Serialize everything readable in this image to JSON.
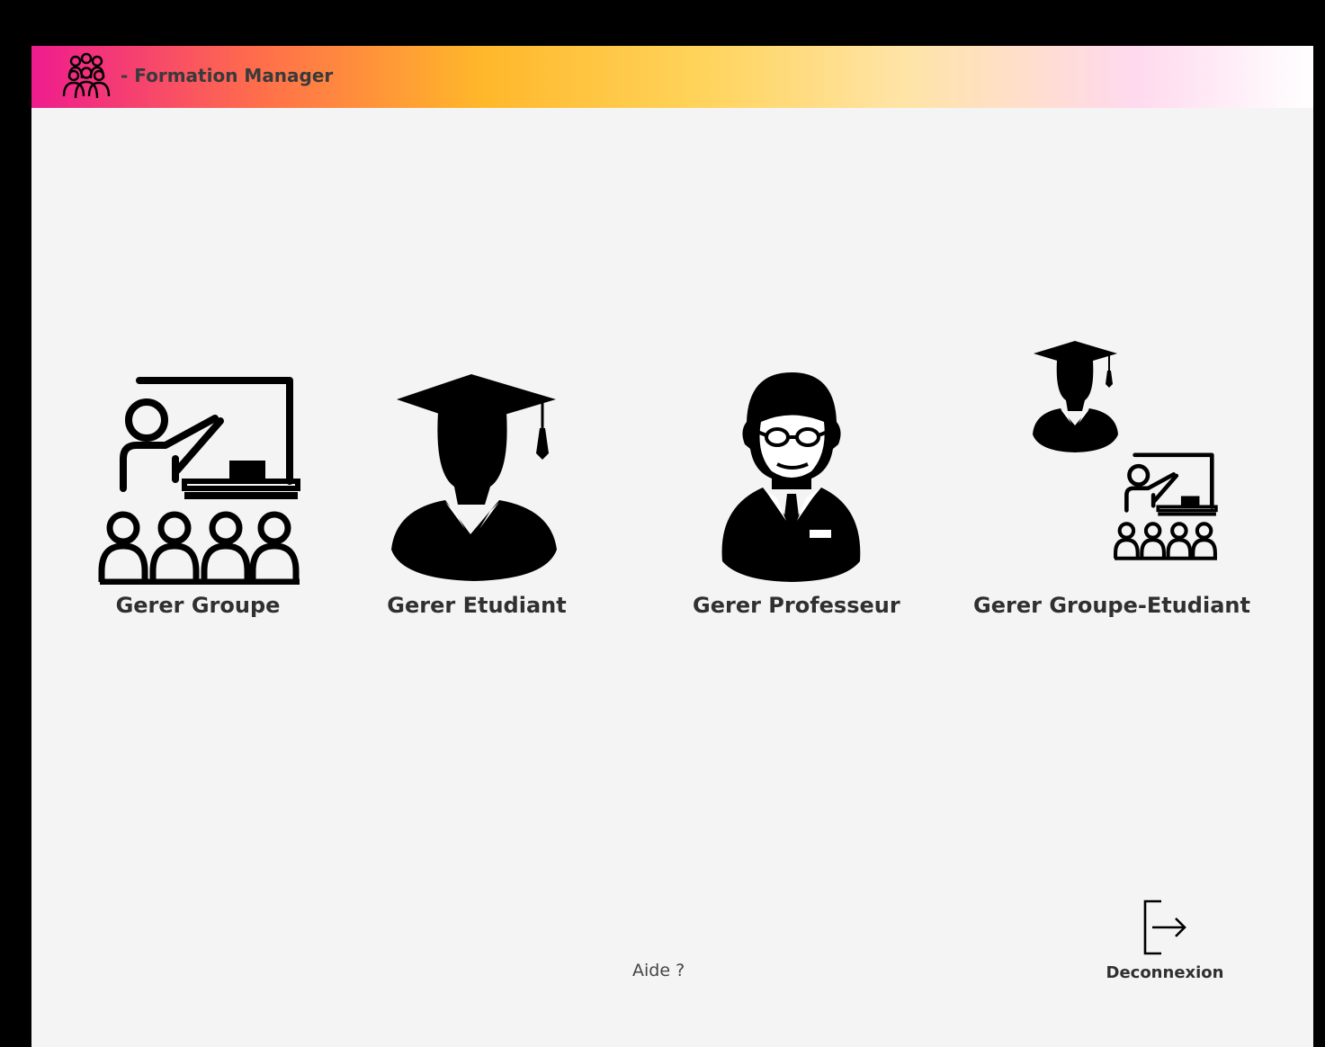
{
  "window": {
    "title": "- Formation Manager",
    "logo_icon": "group-of-people-icon"
  },
  "tiles": [
    {
      "label": "Gerer Groupe",
      "icon": "teacher-classroom-icon"
    },
    {
      "label": "Gerer Etudiant",
      "icon": "graduate-student-icon"
    },
    {
      "label": "Gerer Professeur",
      "icon": "professor-icon"
    },
    {
      "label": "Gerer Groupe-Etudiant",
      "icon": "student-group-icon"
    }
  ],
  "footer": {
    "help_label": "Aide ?",
    "logout_label": "Deconnexion",
    "logout_icon": "logout-arrow-icon"
  },
  "colors": {
    "gradient_start": "#ee1c8e",
    "gradient_mid": "#ffb72a",
    "gradient_end": "#ffffff",
    "background": "#f4f4f4"
  }
}
